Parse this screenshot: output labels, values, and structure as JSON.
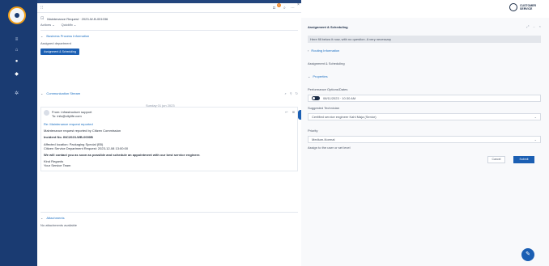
{
  "rail": {
    "items": [
      {
        "icon": "menu-icon"
      },
      {
        "icon": "home-icon"
      },
      {
        "icon": "person-icon"
      },
      {
        "icon": "user-icon"
      },
      {
        "icon": "gear-icon"
      }
    ]
  },
  "header": {
    "notification_count": "1"
  },
  "record": {
    "title": "Maintenance Request · 2023-W-B-001036",
    "actions": [
      "Actions ⌄",
      "Quickfix ⌄"
    ]
  },
  "business_process": {
    "title": "Business Process Information",
    "field_label": "Assigned department",
    "button_label": "Assignment & Scheduling"
  },
  "communication": {
    "title": "Communication Stream",
    "tools": [
      "⌕",
      "⚲",
      "↻"
    ],
    "dated_tag": "Sunday 01 jun 2023",
    "email": {
      "from": "From: infrastructure support",
      "to": "To: info@citylife.com",
      "subject": "Re: Maintenance request reported",
      "line1": "Maintenance request reported by Citizen Commission",
      "number": "Incident No. INC2023-WB-0000B",
      "facility": "Affected location: Packaging Special (B5)",
      "service": "Citizen Service Department Request: 2023-12-08 13:00:00",
      "message": "We will contact you as soon as possible and schedule an appointment with our best service engineer.",
      "sign1": "Kind Regards",
      "sign2": "Your Service Team"
    }
  },
  "attachments": {
    "title": "Attachments",
    "empty_text": "No attachments available"
  },
  "panel": {
    "brand_line1": "CUSTOMER",
    "brand_line2": "SERVICE",
    "title": "Assignment & Scheduling",
    "info": "Here fill below it now, with no question. A very necessary",
    "section1": "Routing Information",
    "label1": "Assignment & Scheduling",
    "section2": "Properties",
    "label2": "Performance Options/Dates",
    "date_value": "08/11/2023 · 10:30 AM",
    "label3": "Suggested Technician",
    "tech_value": "Certified service engineer Kahl Maja (Senior)",
    "label4": "Priority",
    "priority_value": "Medium-Normal",
    "hint": "Assign to the user or set level",
    "cancel_label": "Cancel",
    "submit_label": "Submit"
  }
}
